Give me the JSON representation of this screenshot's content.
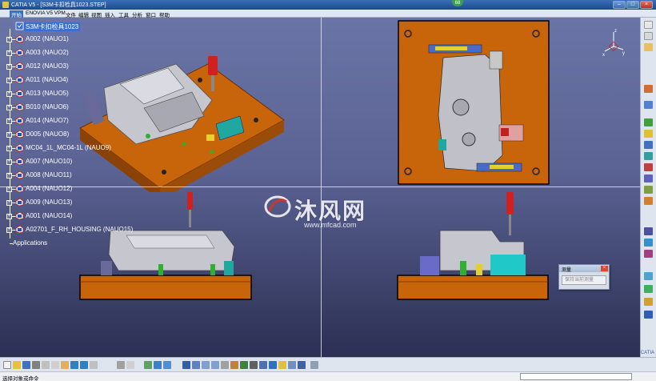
{
  "window": {
    "title": "CATIA V5 - [S3M卡扣检具1023.STEP]",
    "badge": "68",
    "buttons": {
      "minimize": "–",
      "maximize": "□",
      "close": "×"
    }
  },
  "menu": {
    "items": [
      "开始",
      "ENOVIA V5 VPM",
      "文件",
      "编辑",
      "视图",
      "插入",
      "工具",
      "分析",
      "窗口",
      "帮助"
    ]
  },
  "tree": {
    "root": "S3M卡扣检具1023",
    "items": [
      "A002 (NAUO1)",
      "A003 (NAUO2)",
      "A012 (NAUO3)",
      "A011 (NAUO4)",
      "A013 (NAUO5)",
      "B010 (NAUO6)",
      "A014 (NAUO7)",
      "D005 (NAUO8)",
      "MC04_1L_MC04-1L (NAUO9)",
      "A007 (NAUO10)",
      "A008 (NAUO11)",
      "A004 (NAUO12)",
      "A009 (NAUO13)",
      "A001 (NAUO14)",
      "A02701_F_RH_HOUSING (NAUO15)"
    ],
    "applications": "Applications"
  },
  "axis": {
    "x": "x",
    "y": "y",
    "z": "z"
  },
  "dialog": {
    "title": "测量",
    "button": "保持当前测量"
  },
  "watermark": {
    "text": "沐风网",
    "url": "www.mfcad.com"
  },
  "status": {
    "message": "选择对象或命令"
  },
  "catia_logo": "CATIA",
  "colors": {
    "viewport_top": "#6a74a6",
    "viewport_bottom": "#2b2f52",
    "base_plate": "#c8640a",
    "base_plate_dark": "#8a4206",
    "clamp_red": "#d02020",
    "part_gray": "#b8b8c0"
  }
}
